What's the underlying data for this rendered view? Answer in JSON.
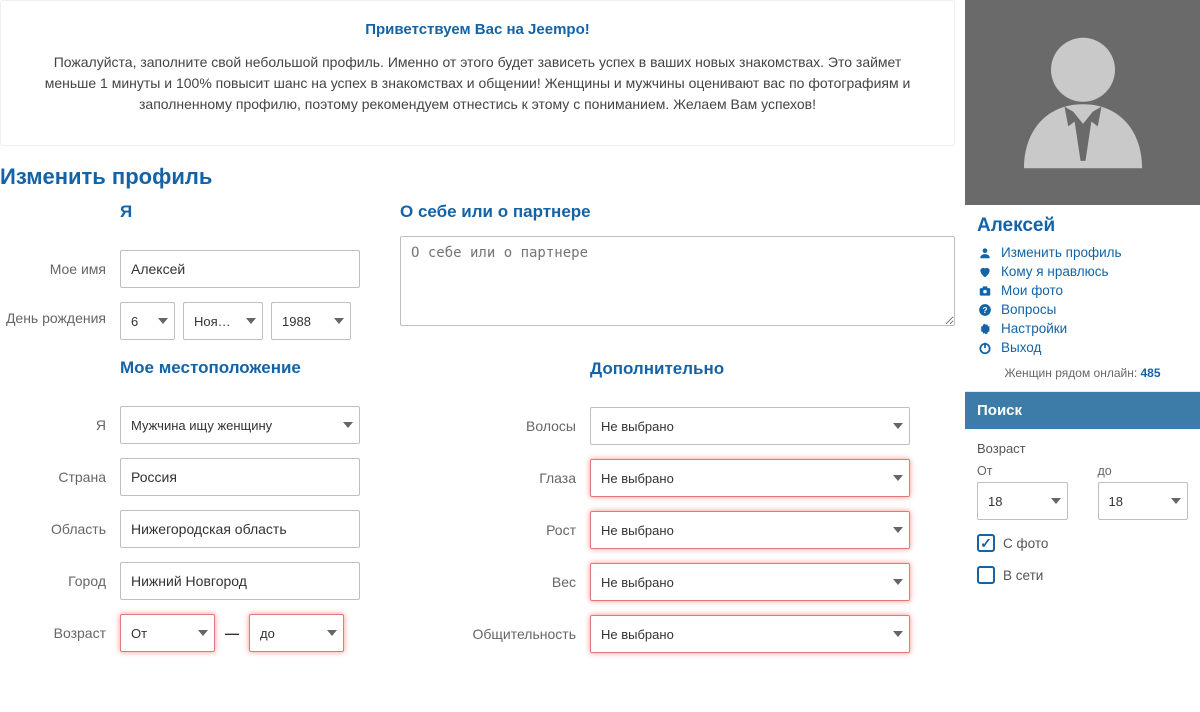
{
  "welcome": {
    "title": "Приветствуем Вас на Jeempo!",
    "text": "Пожалуйста, заполните свой небольшой профиль. Именно от этого будет зависеть успех в ваших новых знакомствах. Это займет меньше 1 минуты и 100% повысит шанс на успех в знакомствах и общении! Женщины и мужчины оценивают вас по фотографиям и заполненному профилю, поэтому рекомендуем отнестись к этому с пониманием. Желаем Вам успехов!"
  },
  "section_title": "Изменить профиль",
  "left": {
    "heading_i": "Я",
    "name_label": "Мое имя",
    "name_value": "Алексей",
    "birthday_label": "День рождения",
    "birth_day": "6",
    "birth_month": "Ноя…",
    "birth_year": "1988",
    "location_heading": "Мое местоположение",
    "seeking_label": "Я",
    "seeking_value": "Мужчина ищу женщину",
    "country_label": "Страна",
    "country_value": "Россия",
    "region_label": "Область",
    "region_value": "Нижегородская область",
    "city_label": "Город",
    "city_value": "Нижний Новгород",
    "age_label": "Возраст",
    "age_from": "От",
    "age_to": "до"
  },
  "right": {
    "about_heading": "О себе или о партнере",
    "about_placeholder": "О себе или о партнере",
    "additional_heading": "Дополнительно",
    "hair_label": "Волосы",
    "eyes_label": "Глаза",
    "height_label": "Рост",
    "weight_label": "Вес",
    "social_label": "Общительность",
    "not_selected": "Не выбрано"
  },
  "sidebar": {
    "name": "Алексей",
    "links": {
      "edit": "Изменить профиль",
      "likes": "Кому я нравлюсь",
      "photos": "Мои фото",
      "questions": "Вопросы",
      "settings": "Настройки",
      "logout": "Выход"
    },
    "online_label": "Женщин рядом онлайн: ",
    "online_count": "485",
    "search_title": "Поиск",
    "search_age_label": "Возраст",
    "age_from_label": "От",
    "age_to_label": "до",
    "age_from": "18",
    "age_to": "18",
    "with_photo": "С фото",
    "online": "В сети"
  }
}
